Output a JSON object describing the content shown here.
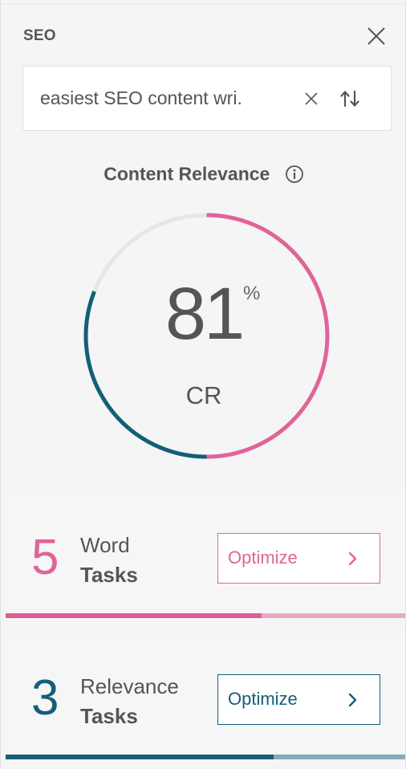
{
  "panel": {
    "title": "SEO"
  },
  "search": {
    "value": "easiest SEO content wri."
  },
  "content_relevance": {
    "heading": "Content Relevance",
    "value": "81",
    "unit": "%",
    "label": "CR",
    "score_fraction": 0.81
  },
  "tasks": [
    {
      "count": "5",
      "title": "Word",
      "subtitle": "Tasks",
      "button_label": "Optimize",
      "progress_fraction": 0.64,
      "accent": "#e0649a"
    },
    {
      "count": "3",
      "title": "Relevance",
      "subtitle": "Tasks",
      "button_label": "Optimize",
      "progress_fraction": 0.67,
      "accent": "#135f77"
    }
  ],
  "colors": {
    "pink": "#e0649a",
    "teal": "#135f77",
    "track": "#e6e6e6"
  },
  "icons": {
    "close": "close-icon",
    "clear": "clear-icon",
    "swap": "swap-icon",
    "info": "info-icon",
    "chevron": "chevron-right-icon"
  }
}
